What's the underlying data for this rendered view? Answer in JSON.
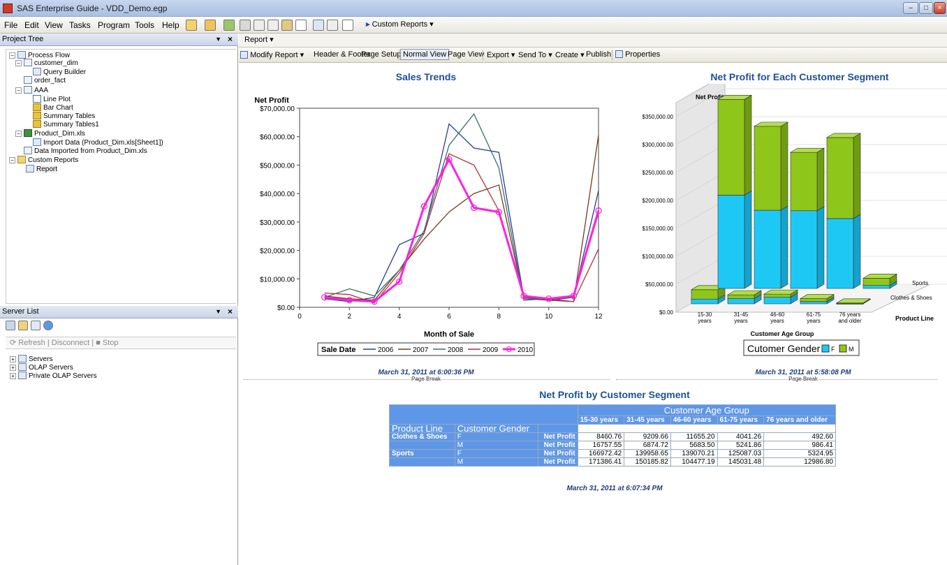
{
  "window": {
    "title": "SAS Enterprise Guide - VDD_Demo.egp"
  },
  "menu": {
    "items": [
      "File",
      "Edit",
      "View",
      "Tasks",
      "Program",
      "Tools",
      "Help"
    ],
    "custom_reports": "Custom Reports"
  },
  "left": {
    "project_tree_title": "Project Tree",
    "server_list_title": "Server List",
    "tree": [
      {
        "label": "Process Flow",
        "icon": "process-flow-icon"
      },
      {
        "label": "customer_dim",
        "icon": "table-icon"
      },
      {
        "label": "Query Builder",
        "icon": "query-icon"
      },
      {
        "label": "order_fact",
        "icon": "table-icon"
      },
      {
        "label": "AAA",
        "icon": "table-icon"
      },
      {
        "label": "Line Plot",
        "icon": "line-plot-icon"
      },
      {
        "label": "Bar Chart",
        "icon": "bar-chart-icon"
      },
      {
        "label": "Summary Tables",
        "icon": "summary-table-icon"
      },
      {
        "label": "Summary Tables1",
        "icon": "summary-table-icon"
      },
      {
        "label": "Product_Dim.xls",
        "icon": "excel-icon"
      },
      {
        "label": "Import Data (Product_Dim.xls[Sheet1])",
        "icon": "import-icon"
      },
      {
        "label": "Data Imported from Product_Dim.xls",
        "icon": "table-icon"
      },
      {
        "label": "Custom Reports",
        "icon": "folder-icon"
      },
      {
        "label": "Report",
        "icon": "report-icon"
      }
    ],
    "server_actions": {
      "refresh": "Refresh",
      "disconnect": "Disconnect",
      "stop": "Stop"
    },
    "servers": [
      {
        "label": "Servers"
      },
      {
        "label": "OLAP Servers"
      },
      {
        "label": "Private OLAP Servers"
      }
    ]
  },
  "report": {
    "tab": "Report",
    "toolbar": {
      "modify": "Modify Report",
      "header_footer": "Header & Footer",
      "page_setup": "Page Setup",
      "normal_view": "Normal View",
      "page_view": "Page View",
      "export": "Export",
      "send_to": "Send To",
      "create": "Create",
      "publish": "Publish",
      "properties": "Properties"
    },
    "page_break": "Page Break",
    "ts1": "March 31, 2011 at 6:00:36 PM",
    "ts2": "March 31, 2011 at 5:58:08 PM",
    "ts3": "March 31, 2011 at 6:07:34 PM"
  },
  "chart_data": [
    {
      "type": "line",
      "title": "Sales Trends",
      "ylabel": "Net Profit",
      "xlabel": "Month of Sale",
      "xlim": [
        0,
        12
      ],
      "ylim": [
        0,
        70000
      ],
      "x_ticks": [
        "0",
        "2",
        "4",
        "6",
        "8",
        "10",
        "12"
      ],
      "y_ticks": [
        "$0.00",
        "$10,000.00",
        "$20,000.00",
        "$30,000.00",
        "$40,000.00",
        "$50,000.00",
        "$60,000.00",
        "$70,000.00"
      ],
      "legend_title": "Sale Date",
      "x": [
        1,
        2,
        3,
        4,
        5,
        6,
        7,
        8,
        9,
        10,
        11,
        12
      ],
      "series": [
        {
          "name": "2006",
          "color": "#2f3a9e",
          "values": [
            3000,
            2000,
            3500,
            22000,
            26000,
            64500,
            56000,
            54500,
            3500,
            2500,
            3500,
            41000
          ]
        },
        {
          "name": "2007",
          "color": "#7a3a1a",
          "values": [
            4000,
            3000,
            2500,
            13000,
            24000,
            33500,
            40000,
            43000,
            3000,
            2500,
            2000,
            60500
          ]
        },
        {
          "name": "2008",
          "color": "#3a6f6a",
          "values": [
            3500,
            6500,
            4000,
            13000,
            27000,
            57000,
            68000,
            49000,
            2500,
            3000,
            4000,
            33000
          ]
        },
        {
          "name": "2009",
          "color": "#b03040",
          "values": [
            5000,
            4500,
            1500,
            12000,
            26000,
            54000,
            50000,
            34000,
            3500,
            3000,
            2000,
            20500
          ]
        },
        {
          "name": "2010",
          "color": "#ff22dd",
          "values": [
            3500,
            2500,
            2000,
            9000,
            35500,
            52000,
            35000,
            33500,
            4000,
            3000,
            4000,
            34000
          ]
        }
      ]
    },
    {
      "type": "bar",
      "stacked": true,
      "three_d": true,
      "title": "Net Profit for Each Customer Segment",
      "ylabel": "Net Profit",
      "xlabel": "Customer Age Group",
      "zlabel": "Product Line",
      "ylim": [
        0,
        350000
      ],
      "y_ticks": [
        "$0.00",
        "$50,000.00",
        "$100,000.00",
        "$150,000.00",
        "$200,000.00",
        "$250,000.00",
        "$300,000.00",
        "$350,000.00"
      ],
      "categories": [
        "15-30 years",
        "31-45 years",
        "46-60 years",
        "61-75 years",
        "76 years and older"
      ],
      "depth": [
        "Sports",
        "Clothes & Shoes"
      ],
      "legend_title": "Cutomer Gender",
      "series_colors": {
        "F": "#1ec8f5",
        "M": "#8fc61a"
      },
      "series": [
        {
          "name": "F",
          "line": "Sports",
          "values": [
            166972.42,
            139958.65,
            139070.21,
            125087.03,
            5324.95
          ]
        },
        {
          "name": "M",
          "line": "Sports",
          "values": [
            171386.41,
            150185.82,
            104477.19,
            145031.48,
            12986.8
          ]
        },
        {
          "name": "F",
          "line": "Clothes & Shoes",
          "values": [
            8460.76,
            9209.66,
            11655.2,
            4041.26,
            492.6
          ]
        },
        {
          "name": "M",
          "line": "Clothes & Shoes",
          "values": [
            16757.55,
            6874.72,
            5683.5,
            5241.86,
            986.41
          ]
        }
      ]
    },
    {
      "type": "table",
      "title": "Net Profit by Customer Segment",
      "col_group": "Customer Age Group",
      "columns": [
        "15-30 years",
        "31-45 years",
        "46-60 years",
        "61-75 years",
        "76 years and older"
      ],
      "row_headers": [
        "Product Line",
        "Customer Gender"
      ],
      "stat": "Net Profit",
      "rows": [
        {
          "line": "Clothes & Shoes",
          "gender": "F",
          "values": [
            "8460.76",
            "9209.66",
            "11655.20",
            "4041.26",
            "492.60"
          ]
        },
        {
          "line": "",
          "gender": "M",
          "values": [
            "16757.55",
            "6874.72",
            "5683.50",
            "5241.86",
            "986.41"
          ]
        },
        {
          "line": "Sports",
          "gender": "F",
          "values": [
            "166972.42",
            "139958.65",
            "139070.21",
            "125087.03",
            "5324.95"
          ]
        },
        {
          "line": "",
          "gender": "M",
          "values": [
            "171386.41",
            "150185.82",
            "104477.19",
            "145031.48",
            "12986.80"
          ]
        }
      ]
    }
  ]
}
